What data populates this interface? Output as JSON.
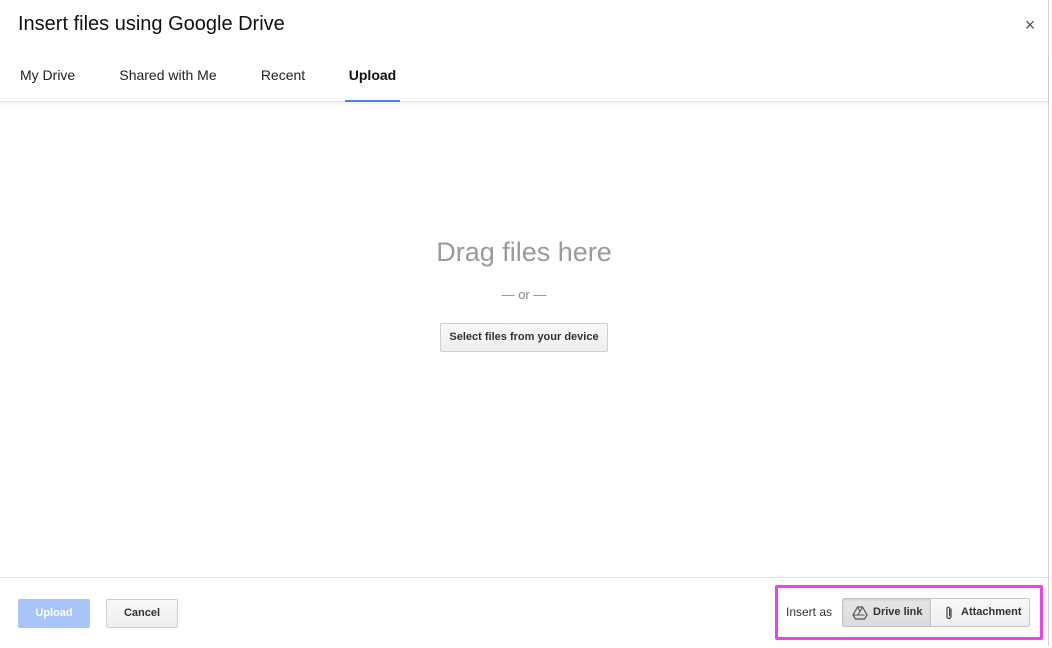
{
  "dialog": {
    "title": "Insert files using Google Drive",
    "close_label": "×"
  },
  "tabs": [
    {
      "label": "My Drive",
      "active": false
    },
    {
      "label": "Shared with Me",
      "active": false
    },
    {
      "label": "Recent",
      "active": false
    },
    {
      "label": "Upload",
      "active": true
    }
  ],
  "upload_area": {
    "drop_text": "Drag files here",
    "or_text": "— or —",
    "select_button_label": "Select files from your device"
  },
  "footer": {
    "upload_label": "Upload",
    "cancel_label": "Cancel",
    "insert_as_label": "Insert as",
    "options": [
      {
        "label": "Drive link",
        "icon": "google-drive-icon",
        "selected": true
      },
      {
        "label": "Attachment",
        "icon": "paperclip-icon",
        "selected": false
      }
    ]
  },
  "colors": {
    "accent": "#4a86e8",
    "upload_disabled": "#a7c6f7",
    "highlight": "#f03ff0",
    "placeholder_text": "#9a9a9a"
  }
}
